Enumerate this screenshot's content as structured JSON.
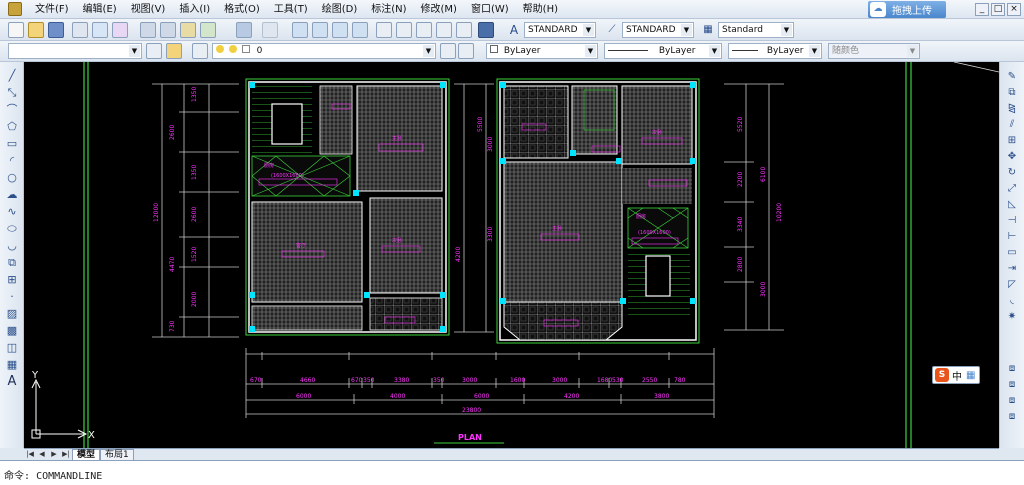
{
  "menu": {
    "items": [
      "文件(F)",
      "编辑(E)",
      "视图(V)",
      "插入(I)",
      "格式(O)",
      "工具(T)",
      "绘图(D)",
      "标注(N)",
      "修改(M)",
      "窗口(W)",
      "帮助(H)"
    ],
    "upload_label": "拖拽上传",
    "upload_icon": "cloud-upload-icon",
    "win_min": "_",
    "win_restore": "□",
    "win_close": "×"
  },
  "styles": {
    "text_style": "STANDARD",
    "dim_style": "STANDARD",
    "table_style": "Standard"
  },
  "layers": {
    "current_layer": "0",
    "color": "ByLayer",
    "linetype": "ByLayer",
    "lineweight": "ByLayer",
    "plot_style": "随颜色"
  },
  "drawing": {
    "plan_label": "PLAN",
    "room_text_a": "主卧",
    "room_text_b": "次卧",
    "room_text_c": "客厅",
    "room_text_d": "厨房",
    "room_note": "(1600X1600)",
    "dim_row1_left": [
      "670",
      "4660",
      "670",
      "350",
      "3380",
      "350"
    ],
    "dim_row1_right": [
      "3000",
      "1600",
      "3000",
      "1680",
      "530",
      "2550",
      "780"
    ],
    "dim_row2": [
      "6000",
      "4000",
      "6000",
      "4200",
      "3800"
    ],
    "dim_total": "23800",
    "dim_left_side": [
      "1350",
      "2600",
      "1350",
      "2600",
      "1520",
      "2000",
      "4470",
      "730",
      "12000"
    ],
    "dim_right_side": [
      "5520",
      "2200",
      "3340",
      "2800",
      "6100",
      "3000",
      "10200"
    ],
    "dim_mid_left": [
      "4200",
      "5500"
    ],
    "dim_mid_right": [
      "3300",
      "3000"
    ]
  },
  "ucs": {
    "x_label": "X",
    "y_label": "Y"
  },
  "tabs": {
    "model": "模型",
    "layout1": "布局1"
  },
  "command": {
    "prompt": "命令:",
    "text": "COMMANDLINE"
  },
  "ime": {
    "logo": "S",
    "label": "中",
    "extra": "▦"
  },
  "colors": {
    "wall": "#ffffff",
    "green": "#3cd23c",
    "cyan": "#00e5ff",
    "magenta": "#ff33ff",
    "hatch": "#8a8a8a",
    "dim": "#c8c8c8",
    "canvas": "#000000"
  }
}
